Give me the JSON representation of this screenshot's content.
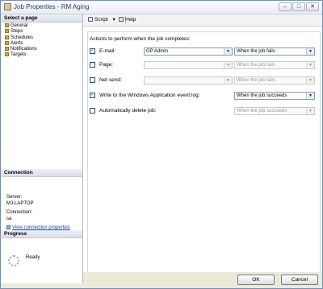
{
  "window": {
    "title": "Job Properties - RM Aging",
    "min": "–",
    "max": "□",
    "close": "✕"
  },
  "left": {
    "select_page_header": "Select a page",
    "pages": [
      "General",
      "Steps",
      "Schedules",
      "Alerts",
      "Notifications",
      "Targets"
    ],
    "connection_header": "Connection",
    "server_label": "Server:",
    "server_value": "MJ-LAPTOP",
    "connection_label": "Connection:",
    "connection_value": "sa",
    "view_connection_link": "View connection properties",
    "progress_header": "Progress",
    "progress_status": "Ready"
  },
  "toolbar": {
    "script_label": "Script",
    "script_dropdown": "▾",
    "help_label": "Help"
  },
  "notifications": {
    "heading": "Actions to perform when the job completes:",
    "rows": [
      {
        "label": "E-mail:",
        "checked": true,
        "target": "GP Admin",
        "condition": "When the job fails",
        "target_enabled": true,
        "condition_enabled": true
      },
      {
        "label": "Page:",
        "checked": false,
        "target": "",
        "condition": "When the job fails",
        "target_enabled": false,
        "condition_enabled": false
      },
      {
        "label": "Net send:",
        "checked": false,
        "target": "",
        "condition": "When the job fails",
        "target_enabled": false,
        "condition_enabled": false
      },
      {
        "label": "Write to the Windows Application event log:",
        "checked": true,
        "condition": "When the job succeeds",
        "condition_enabled": true
      },
      {
        "label": "Automatically delete job:",
        "checked": false,
        "condition": "When the job succeeds",
        "condition_enabled": false
      }
    ],
    "check_mark": "✓",
    "arrow": "▼"
  },
  "buttons": {
    "ok": "OK",
    "cancel": "Cancel"
  }
}
